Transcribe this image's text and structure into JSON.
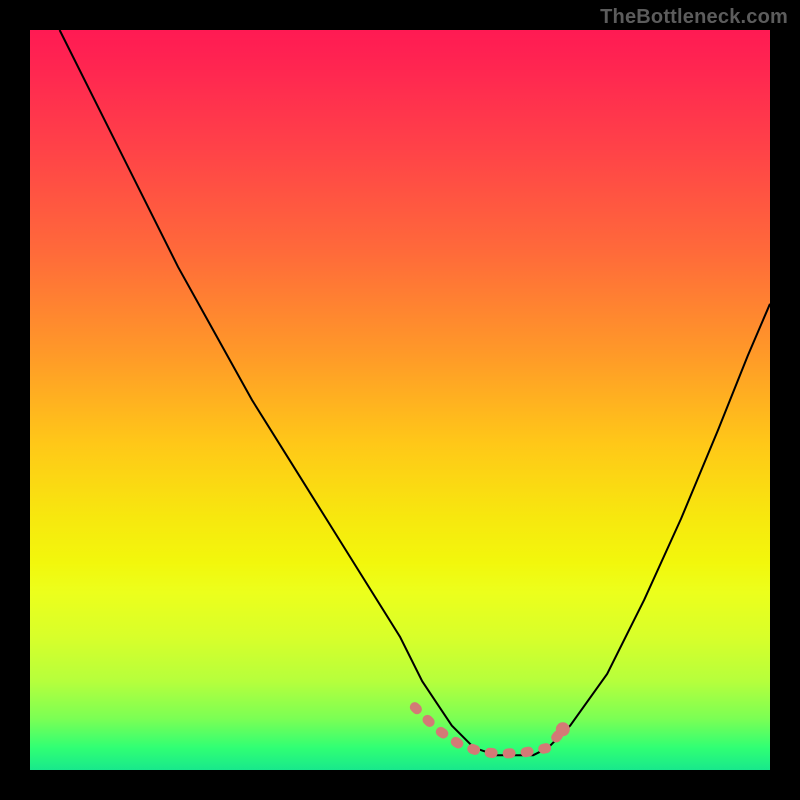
{
  "watermark": "TheBottleneck.com",
  "chart_data": {
    "type": "line",
    "title": "",
    "xlabel": "",
    "ylabel": "",
    "xlim": [
      0,
      100
    ],
    "ylim": [
      0,
      100
    ],
    "series": [
      {
        "name": "curve",
        "color": "#000000",
        "stroke_width": 2,
        "x": [
          4,
          10,
          15,
          20,
          25,
          30,
          35,
          40,
          45,
          50,
          53,
          55,
          57,
          60,
          63,
          66,
          68,
          70,
          73,
          78,
          83,
          88,
          93,
          97,
          100
        ],
        "y": [
          100,
          88,
          78,
          68,
          59,
          50,
          42,
          34,
          26,
          18,
          12,
          9,
          6,
          3,
          2,
          2,
          2,
          3,
          6,
          13,
          23,
          34,
          46,
          56,
          63
        ]
      },
      {
        "name": "dotted-band",
        "color": "#d37a76",
        "stroke_width": 10,
        "linecap": "round",
        "dasharray": "3 15",
        "x": [
          52,
          55,
          58,
          61,
          64,
          67,
          70,
          72
        ],
        "y": [
          8.5,
          5.5,
          3.5,
          2.4,
          2.2,
          2.4,
          3.0,
          5.5
        ]
      }
    ],
    "marker": {
      "name": "end-dot",
      "color": "#d37a76",
      "x": 72,
      "y": 5.5,
      "r": 7
    }
  }
}
